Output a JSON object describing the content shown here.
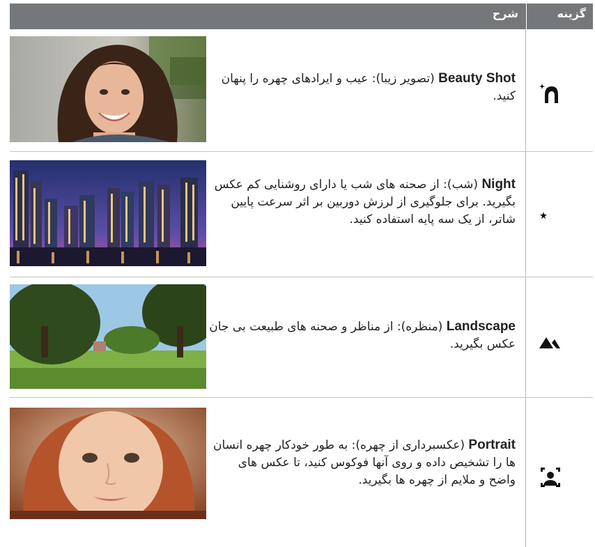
{
  "header": {
    "description_col": "شرح",
    "option_col": "گزینه"
  },
  "rows": [
    {
      "term": "Beauty Shot",
      "text": " (تصویر زیبا): عیب و ایرادهای چهره را پنهان کنید.",
      "icon": "beauty-face-icon"
    },
    {
      "term": "Night",
      "text": " (شب): از صحنه های شب یا دارای روشنایی کم عکس بگیرید. برای جلوگیری از لرزش دوربین بر اثر سرعت پایین شاتر، از یک سه پایه استفاده کنید.",
      "icon": "moon-star-icon"
    },
    {
      "term": "Landscape",
      "text": " (منظره): از مناظر و صحنه های طبیعت بی جان عکس بگیرید.",
      "icon": "mountain-icon"
    },
    {
      "term": "Portrait",
      "text": " (عکسبرداری از چهره): به طور خودکار چهره انسان ها را تشخیص داده و روی آنها فوکوس کنید، تا عکس های واضح و ملایم از چهره ها بگیرید.",
      "icon": "portrait-frame-icon"
    }
  ]
}
